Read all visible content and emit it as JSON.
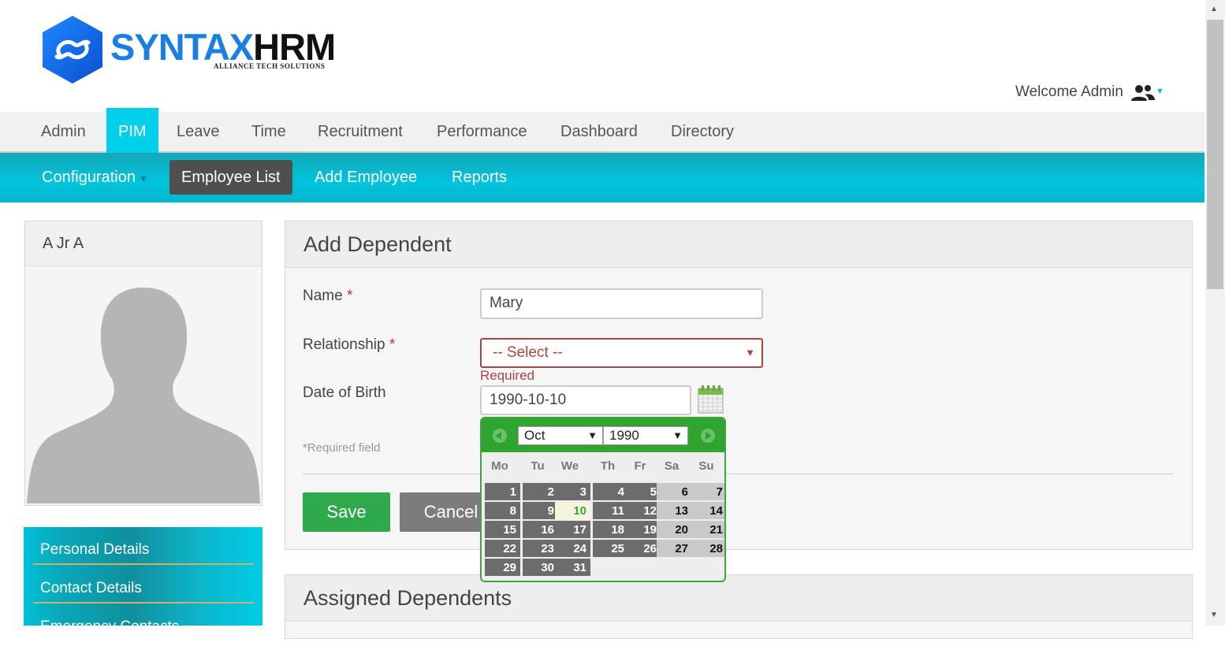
{
  "header": {
    "logo_main_blue": "SYNTAX",
    "logo_main_dark": "HRM",
    "logo_sub": "ALLIANCE TECH SOLUTIONS",
    "welcome": "Welcome Admin",
    "icons": {
      "logo": "syntax-hex-logo",
      "user": "users-icon",
      "user_menu": "caret-down-icon"
    }
  },
  "main_nav": {
    "items": [
      {
        "label": "Admin"
      },
      {
        "label": "PIM",
        "active": true
      },
      {
        "label": "Leave"
      },
      {
        "label": "Time"
      },
      {
        "label": "Recruitment"
      },
      {
        "label": "Performance"
      },
      {
        "label": "Dashboard"
      },
      {
        "label": "Directory"
      }
    ]
  },
  "sub_nav": {
    "items": [
      {
        "label": "Configuration",
        "has_dropdown": true
      },
      {
        "label": "Employee List",
        "active": true
      },
      {
        "label": "Add Employee"
      },
      {
        "label": "Reports"
      }
    ]
  },
  "profile": {
    "name": "A Jr A",
    "menu": [
      {
        "label": "Personal Details"
      },
      {
        "label": "Contact Details"
      },
      {
        "label": "Emergency Contacts"
      }
    ]
  },
  "add_dependent": {
    "title": "Add Dependent",
    "name_label": "Name",
    "name_value": "Mary",
    "relationship_label": "Relationship",
    "relationship_value": "-- Select --",
    "relationship_error": "Required",
    "dob_label": "Date of Birth",
    "dob_value": "1990-10-10",
    "required_star": "*",
    "required_note": "*Required field",
    "save_label": "Save",
    "cancel_label": "Cancel"
  },
  "datepicker": {
    "month": "Oct",
    "year": "1990",
    "weekdays": [
      "Mo",
      "Tu",
      "We",
      "Th",
      "Fr",
      "Sa",
      "Su"
    ],
    "first_weekday_index": 0,
    "days_in_month": 31,
    "selected_day": 10,
    "colors": {
      "header": "#2fa52f",
      "weekday_cell": "#6c6c6c",
      "weekend_cell": "#c9c9c9",
      "today_text": "#3fa53a"
    }
  },
  "assigned_dependents": {
    "title": "Assigned Dependents"
  },
  "colors": {
    "accent_cyan": "#00d0ea",
    "save_green": "#2eaa4c",
    "error_red": "#a94442"
  }
}
